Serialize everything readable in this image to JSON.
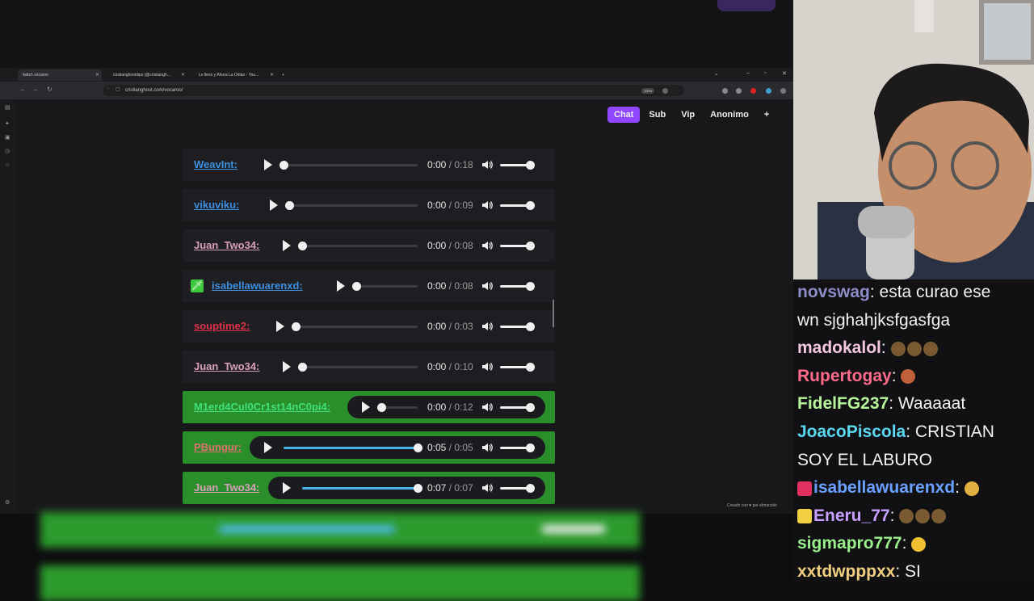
{
  "browser": {
    "tabs": [
      {
        "label": "twitch vocaroo"
      },
      {
        "label": "cristianghostdips (@cristiangh..."
      },
      {
        "label": "Lo llevo y Ahora La Odian - You..."
      }
    ],
    "new_tab": "+",
    "url": "cristianghost.com/vocaroo/",
    "zoom": "100%"
  },
  "page": {
    "nav": [
      "Chat",
      "Sub",
      "Vip",
      "Anonimo",
      "+"
    ],
    "credit": "Creado con ♥ por elmarcelo"
  },
  "clips": [
    {
      "user": "WeavInt:",
      "current": "0:00",
      "duration": "0:18",
      "progress": 0,
      "color": "#3d8fe0",
      "played": false
    },
    {
      "user": "vikuviku:",
      "current": "0:00",
      "duration": "0:09",
      "progress": 0,
      "color": "#3d8fe0",
      "played": false
    },
    {
      "user": "Juan_Two34:",
      "current": "0:00",
      "duration": "0:08",
      "progress": 0,
      "color": "#d8a0b8",
      "played": false
    },
    {
      "user": "isabellawuarenxd:",
      "current": "0:00",
      "duration": "0:08",
      "progress": 0,
      "color": "#3d8fe0",
      "played": false,
      "badge": true
    },
    {
      "user": "souptime2:",
      "current": "0:00",
      "duration": "0:03",
      "progress": 0,
      "color": "#e0304a",
      "played": false
    },
    {
      "user": "Juan_Two34:",
      "current": "0:00",
      "duration": "0:10",
      "progress": 0,
      "color": "#d8a0b8",
      "played": false
    },
    {
      "user": "M1erd4Cul0Cr1st14nC0pi4:",
      "current": "0:00",
      "duration": "0:12",
      "progress": 0,
      "color": "#3fe07a",
      "played": true
    },
    {
      "user": "PBungur:",
      "current": "0:05",
      "duration": "0:05",
      "progress": 1,
      "color": "#e07070",
      "played": true
    },
    {
      "user": "Juan_Two34:",
      "current": "0:07",
      "duration": "0:07",
      "progress": 1,
      "color": "#d8a0b8",
      "played": true
    }
  ],
  "chat": [
    {
      "user": "novswag",
      "color": "#8c8cc8",
      "text": "esta curao ese"
    },
    {
      "user": "",
      "color": "#f2f2f2",
      "text": "wn sjghahjksfgasfga"
    },
    {
      "user": "madokalol",
      "color": "#f5c8e0",
      "text": ""
    },
    {
      "user": "Rupertogay",
      "color": "#ff6b8a",
      "text": ""
    },
    {
      "user": "FidelFG237",
      "color": "#b8f59a",
      "text": "Waaaaat"
    },
    {
      "user": "JoacoPiscola",
      "color": "#5ad8f0",
      "text": "CRISTIAN"
    },
    {
      "user": "",
      "color": "#f2f2f2",
      "text": "SOY EL LABURO"
    },
    {
      "user": "isabellawuarenxd",
      "color": "#6aa0ff",
      "text": ""
    },
    {
      "user": "Eneru_77",
      "color": "#c8a0ff",
      "text": ""
    },
    {
      "user": "sigmapro777",
      "color": "#9af08a",
      "text": ""
    },
    {
      "user": "xxtdwpppxx",
      "color": "#f0d080",
      "text": "SI"
    }
  ]
}
